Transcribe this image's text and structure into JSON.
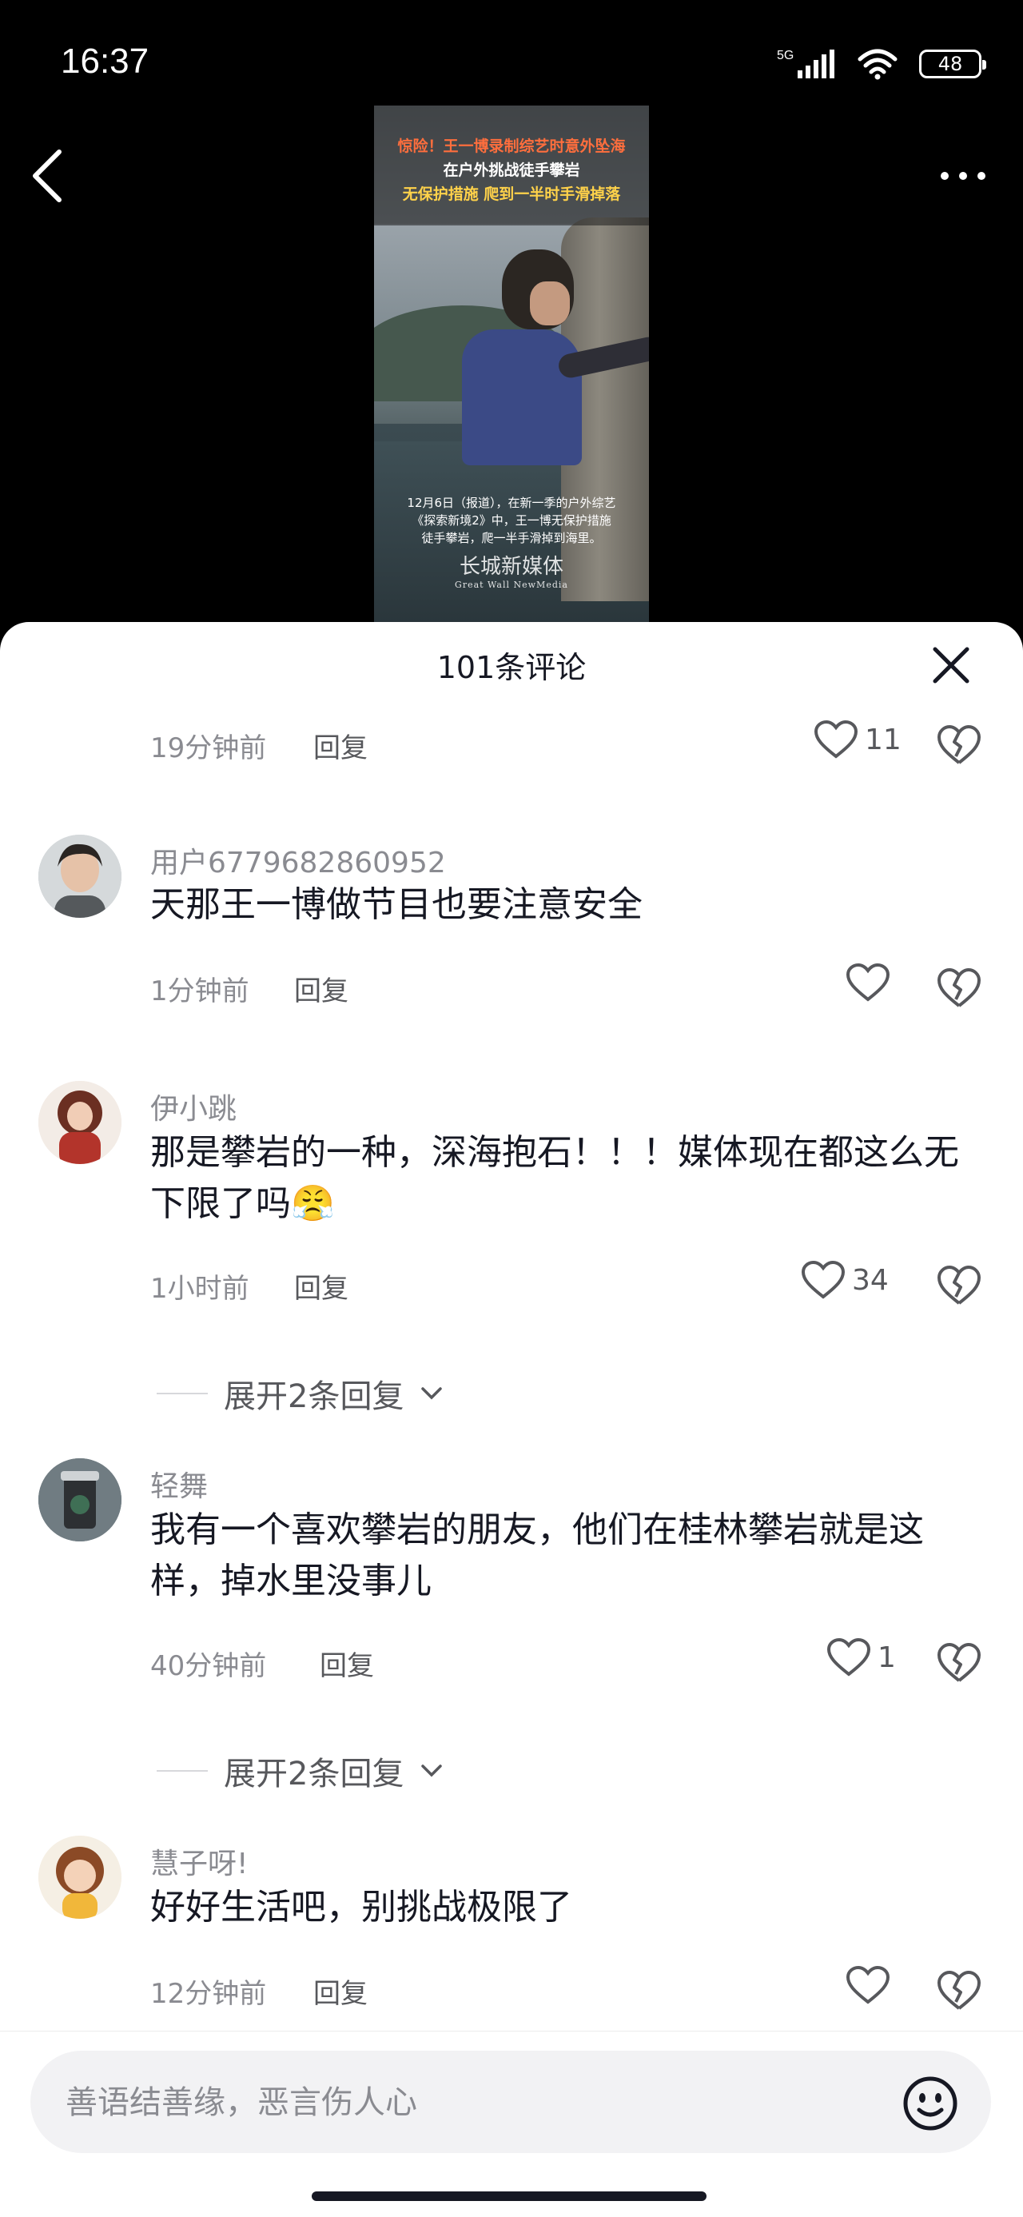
{
  "status": {
    "time": "16:37",
    "network": "5G",
    "battery": "48"
  },
  "video": {
    "caption_line1": "惊险！王一博录制综艺时意外坠海",
    "caption_line2": "在户外挑战徒手攀岩",
    "caption_line3": "无保护措施 爬到一半时手滑掉落",
    "bottom_line1": "12月6日（报道），在新一季的户外综艺",
    "bottom_line2": "《探索新境2》中，王一博无保护措施",
    "bottom_line3": "徒手攀岩，爬一半手滑掉到海里。",
    "watermark": "长城新媒体",
    "watermark_en": "Great Wall NewMedia"
  },
  "sheet": {
    "title": "101条评论"
  },
  "comments": [
    {
      "time": "19分钟前",
      "reply": "回复",
      "likes": "11"
    },
    {
      "user": "用户6779682860952",
      "text": "天那王一博做节目也要注意安全",
      "time": "1分钟前",
      "reply": "回复",
      "likes": ""
    },
    {
      "user": "伊小跳",
      "text": "那是攀岩的一种，深海抱石！！！媒体现在都这么无下限了吗",
      "emoji": "😤",
      "time": "1小时前",
      "reply": "回复",
      "likes": "34",
      "expand": "展开2条回复"
    },
    {
      "user": "轻舞",
      "text": "我有一个喜欢攀岩的朋友，他们在桂林攀岩就是这样，掉水里没事儿",
      "time": "40分钟前",
      "reply": "回复",
      "likes": "1",
      "expand": "展开2条回复"
    },
    {
      "user": "慧子呀!",
      "text": "好好生活吧，别挑战极限了",
      "time": "12分钟前",
      "reply": "回复",
      "likes": ""
    }
  ],
  "input": {
    "placeholder": "善语结善缘，恶言伤人心"
  },
  "colors": {
    "text": "#161823",
    "muted": "#8a8b91",
    "sheet": "#ffffff"
  }
}
